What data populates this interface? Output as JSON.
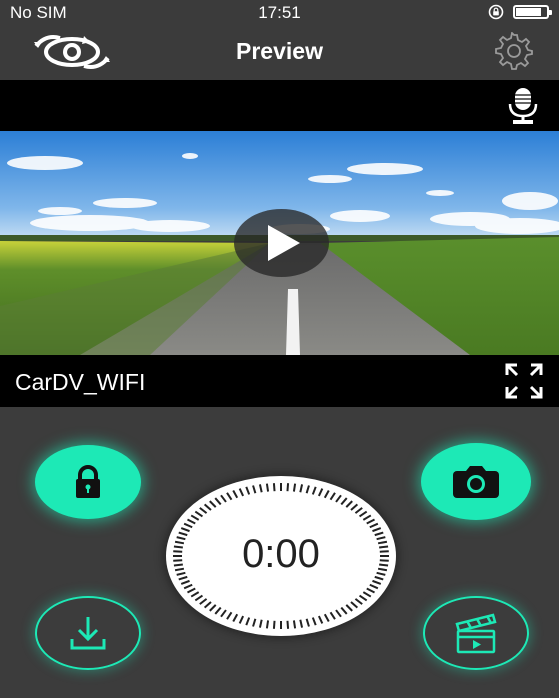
{
  "status_bar": {
    "carrier": "No SIM",
    "time": "17:51",
    "battery_level": 0.82
  },
  "nav": {
    "title": "Preview",
    "logo_icon": "camera-logo-icon",
    "settings_icon": "gear-icon"
  },
  "audio": {
    "icon": "microphone-icon"
  },
  "video": {
    "device_name": "CarDV_WIFI",
    "play_icon": "play-icon",
    "fullscreen_icon": "fullscreen-icon"
  },
  "controls": {
    "lock_icon": "lock-icon",
    "photo_icon": "camera-icon",
    "download_icon": "download-icon",
    "video_list_icon": "clapperboard-icon",
    "timer": "0:00"
  },
  "colors": {
    "accent": "#1de9b6",
    "background": "#3c3c3c",
    "bar": "#000000"
  }
}
